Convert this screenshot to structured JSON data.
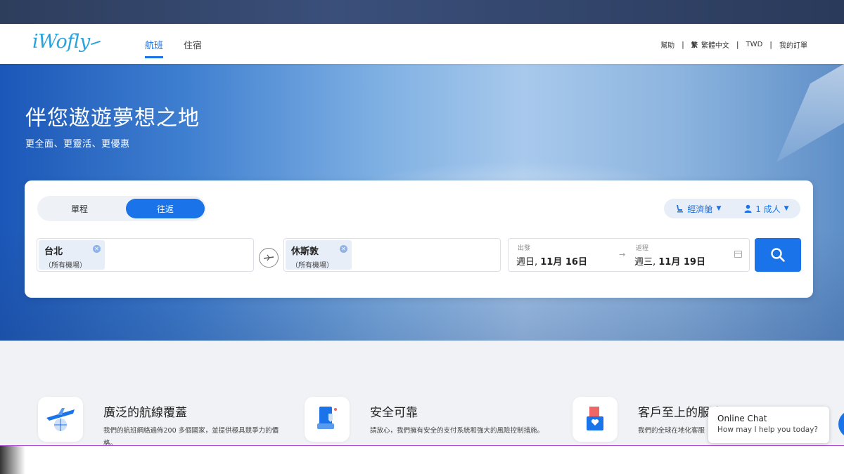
{
  "brand": {
    "logo": "iWofly"
  },
  "nav": {
    "tabs": [
      "航班",
      "住宿"
    ],
    "right": {
      "help": "幫助",
      "lang_glyph": "繁",
      "lang": "繁體中文",
      "currency": "TWD",
      "orders": "我的訂單"
    }
  },
  "hero": {
    "title": "伴您遨遊夢想之地",
    "subtitle": "更全面、更靈活、更優惠"
  },
  "search": {
    "trip_types": {
      "oneway": "單程",
      "round": "往返",
      "selected": "往返"
    },
    "cabin": "經濟艙",
    "passengers": "1 成人",
    "origin": {
      "city": "台北",
      "airport": "（所有機場）"
    },
    "destination": {
      "city": "休斯敦",
      "airport": "（所有機場）"
    },
    "depart": {
      "label": "出發",
      "weekday": "週日, ",
      "date": "11月 16日"
    },
    "return": {
      "label": "返程",
      "weekday": "週三, ",
      "date": "11月 19日"
    }
  },
  "features": [
    {
      "title": "廣泛的航線覆蓋",
      "desc": "我們的航班網絡遍佈200 多個國家，並提供極具競爭力的價格。"
    },
    {
      "title": "安全可靠",
      "desc": "請放心，我們擁有安全的支付系統和強大的風險控制措施。"
    },
    {
      "title": "客戶至上的服務",
      "desc": "我們的全球在地化客服"
    }
  ],
  "chat": {
    "title": "Online Chat",
    "subtitle": "How may I help you today?"
  },
  "colors": {
    "primary": "#1a73e8",
    "logo": "#2aa3dc",
    "band": "#f0f2f5"
  }
}
